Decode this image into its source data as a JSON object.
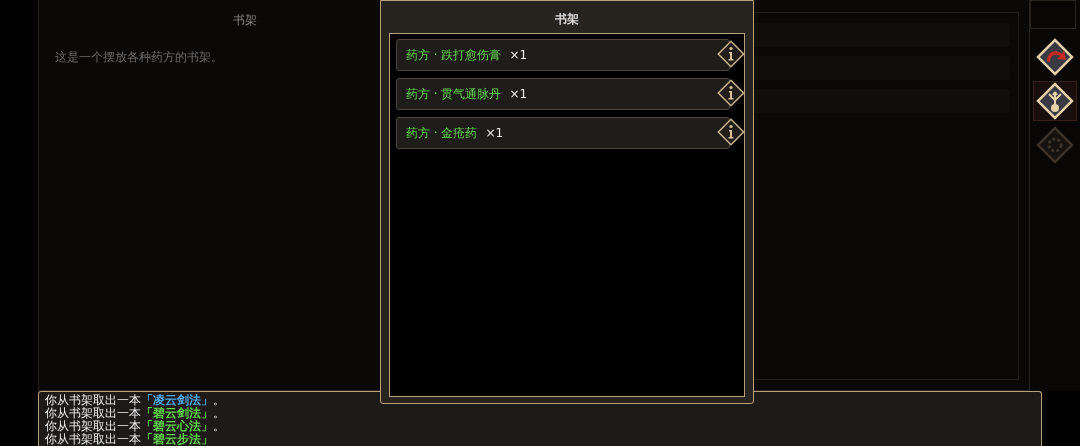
{
  "background_panel": {
    "title": "书架",
    "description": "这是一个摆放各种药方的书架。"
  },
  "dialog": {
    "title": "书架",
    "items": [
      {
        "name": "药方 · 跌打愈伤膏",
        "count": "×1"
      },
      {
        "name": "药方 · 贯气通脉丹",
        "count": "×1"
      },
      {
        "name": "药方 · 金疮药",
        "count": "×1"
      }
    ]
  },
  "side_buttons": [
    {
      "kind": "redo",
      "selected": false,
      "disabled": false
    },
    {
      "kind": "trident",
      "selected": true,
      "disabled": false
    },
    {
      "kind": "gear",
      "selected": false,
      "disabled": true
    }
  ],
  "log": [
    {
      "prefix": "你从书架取出一本",
      "item": "「凌云剑法」",
      "suffix": "。",
      "color": "#4fa8e6"
    },
    {
      "prefix": "你从书架取出一本",
      "item": "「碧云剑法」",
      "suffix": "。",
      "color": "#62d84c"
    },
    {
      "prefix": "你从书架取出一本",
      "item": "「碧云心法」",
      "suffix": "。",
      "color": "#62d84c"
    },
    {
      "prefix": "你从书架取出一本",
      "item": "「碧云步法」",
      "color": "#62d84c"
    }
  ]
}
